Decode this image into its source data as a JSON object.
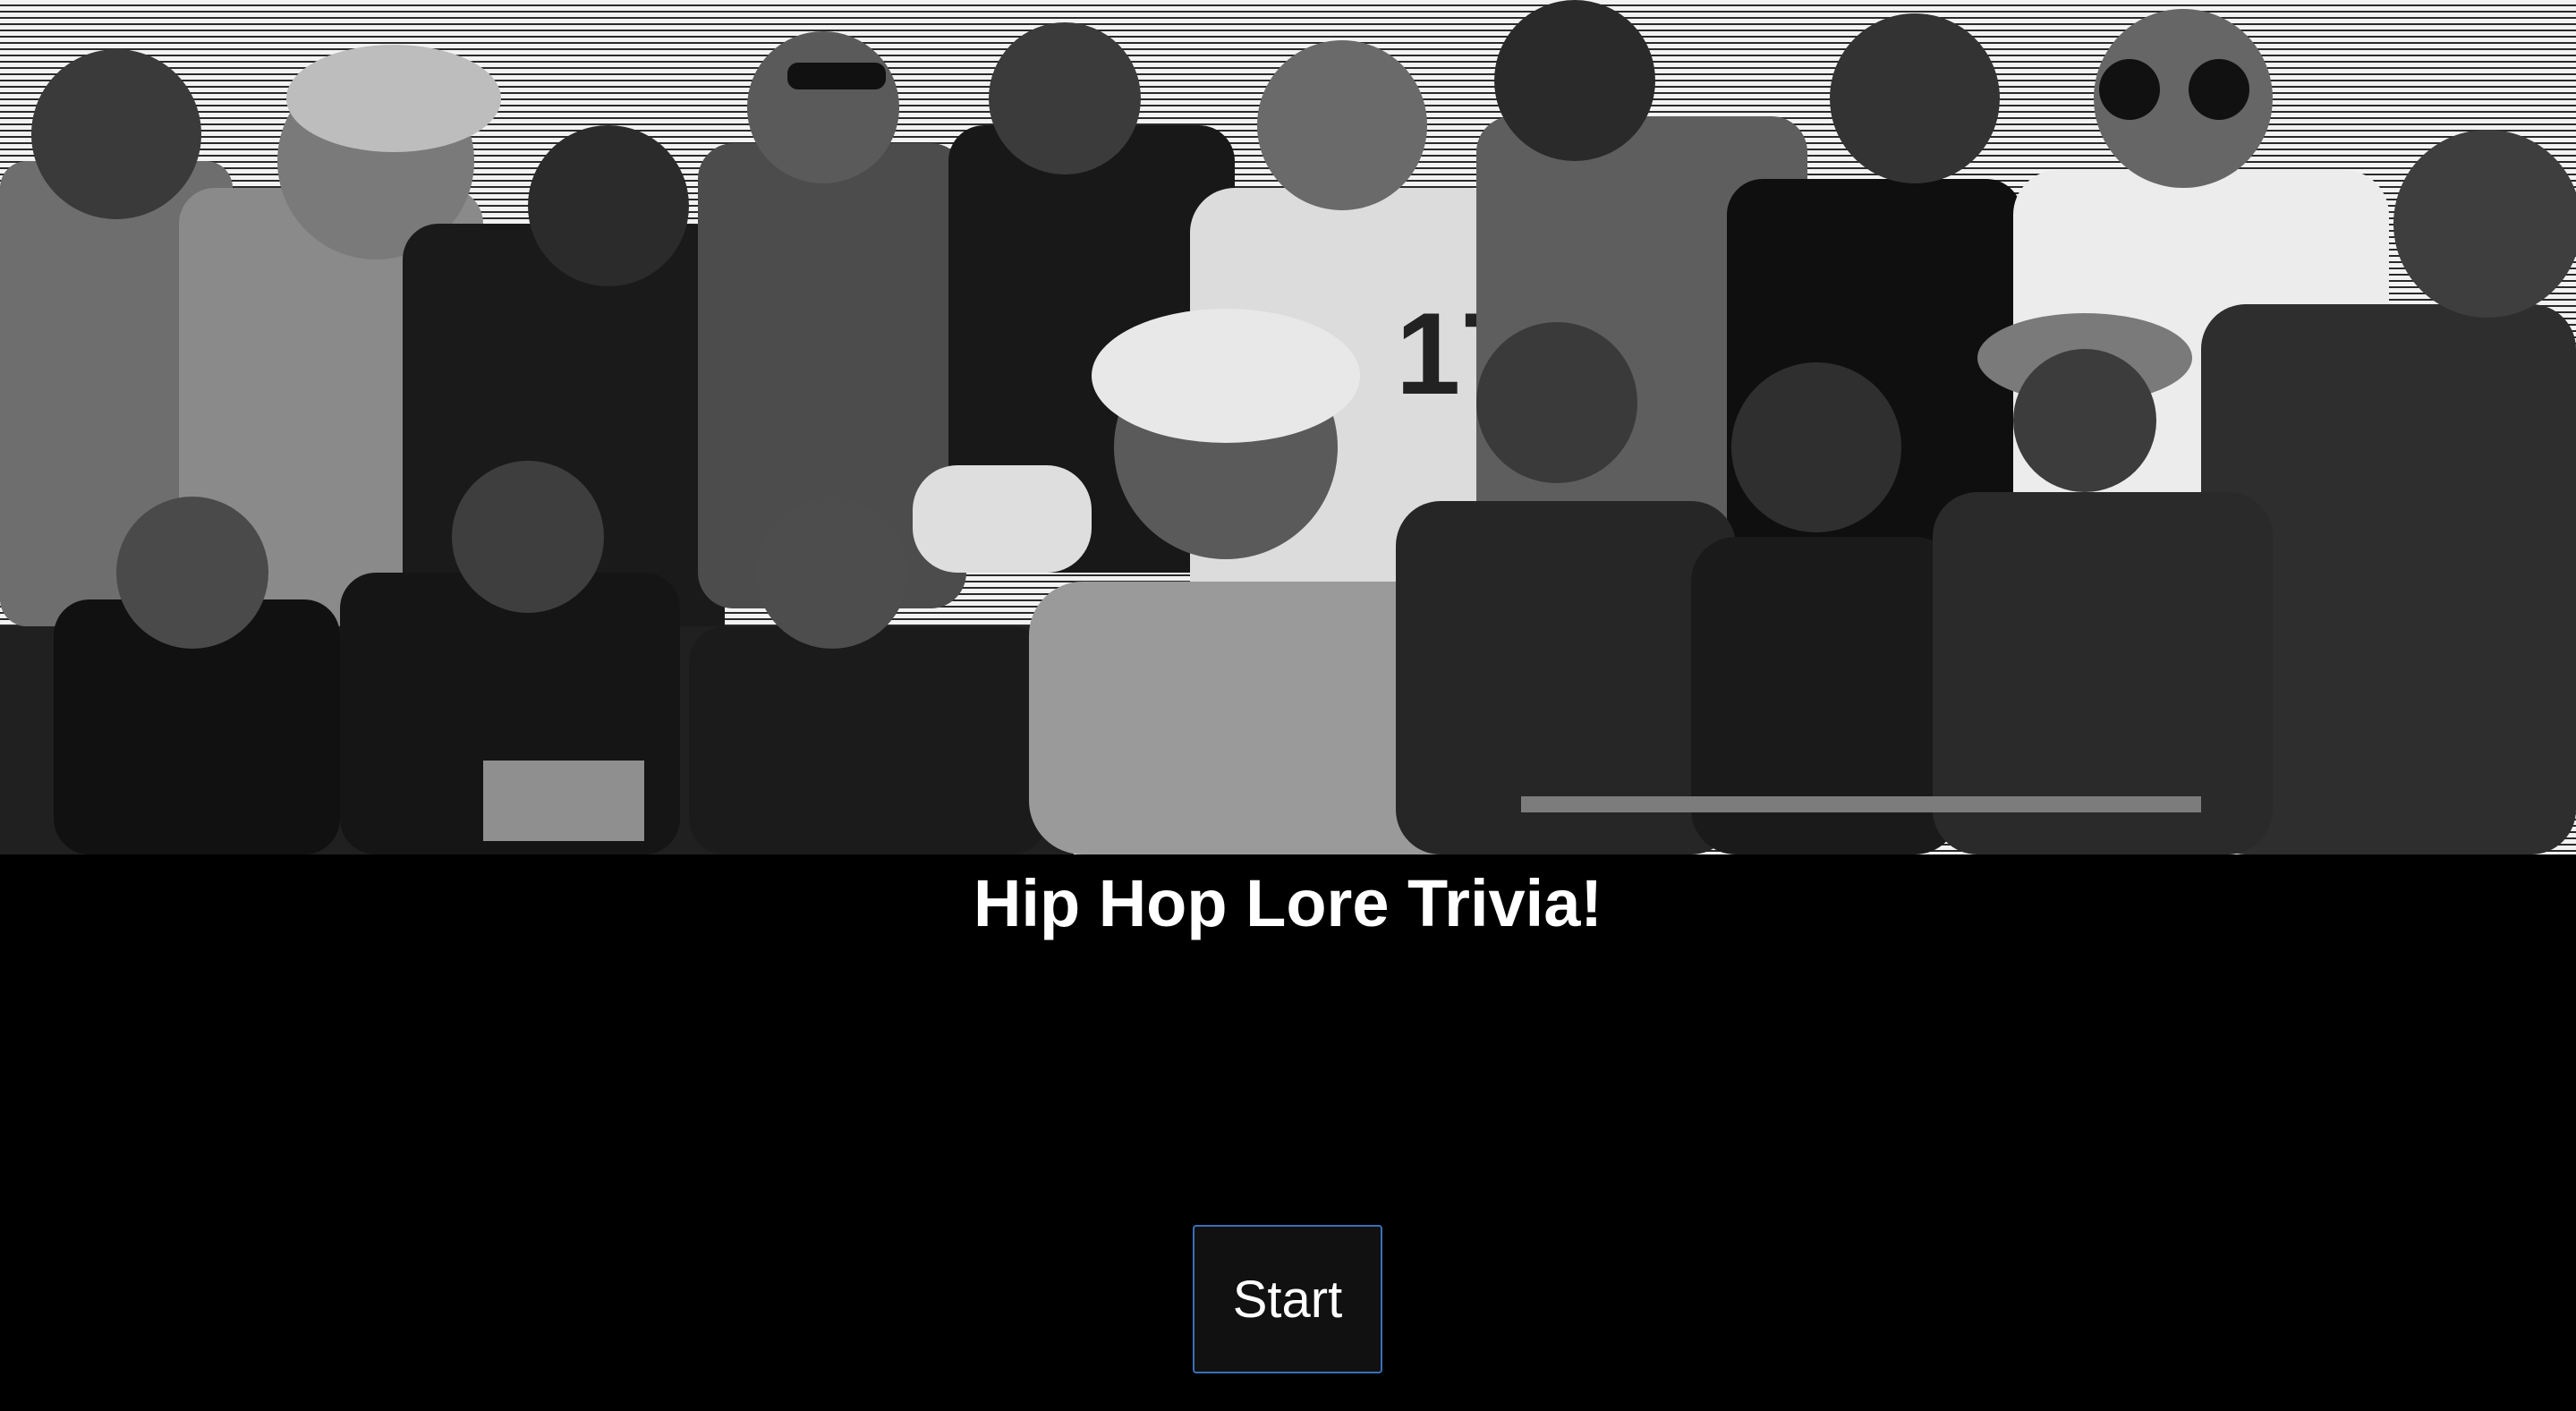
{
  "hero": {
    "image_icon": "hip-hop-artists-collage"
  },
  "title": "Hip Hop Lore Trivia!",
  "start_button": {
    "label": "Start"
  },
  "colors": {
    "background": "#000000",
    "title": "#ffffff",
    "button_background": "#111111",
    "button_border": "#3b6fb8",
    "button_text": "#ffffff"
  }
}
